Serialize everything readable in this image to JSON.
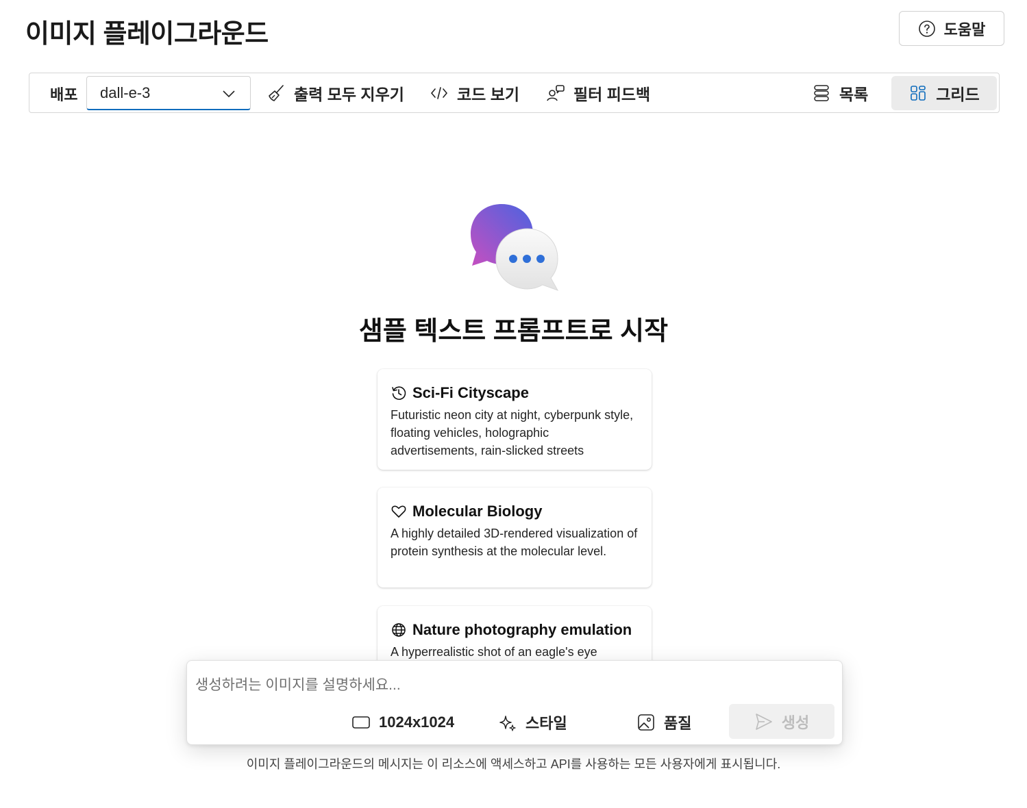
{
  "page": {
    "title": "이미지 플레이그라운드"
  },
  "help": {
    "label": "도움말",
    "icon": "question-circle-icon"
  },
  "toolbar": {
    "deploy_label": "배포",
    "deploy_value": "dall-e-3",
    "clear_label": "출력 모두 지우기",
    "code_label": "코드 보기",
    "feedback_label": "필터 피드백",
    "list_label": "목록",
    "grid_label": "그리드",
    "active_view": "grid"
  },
  "hero": {
    "title": "샘플 텍스트 프롬프트로 시작"
  },
  "samples": [
    {
      "title": "Sci-Fi Cityscape",
      "icon": "history-icon",
      "description": "Futuristic neon city at night, cyberpunk style, floating vehicles, holographic advertisements, rain-slicked streets"
    },
    {
      "title": "Molecular Biology",
      "icon": "heart-icon",
      "description": "A highly detailed 3D-rendered visualization of protein synthesis at the molecular level."
    },
    {
      "title": "Nature photography emulation",
      "icon": "globe-icon",
      "description": "A hyperrealistic shot of an eagle's eye"
    }
  ],
  "composer": {
    "placeholder": "생성하려는 이미지를 설명하세요...",
    "size_label": "1024x1024",
    "style_label": "스타일",
    "quality_label": "품질",
    "generate_label": "생성"
  },
  "footer": {
    "note": "이미지 플레이그라운드의 메시지는 이 리소스에 액세스하고 API를 사용하는 모든 사용자에게 표시됩니다."
  },
  "colors": {
    "accent": "#0f6cbd",
    "hero_gradient_start": "#6a5be0",
    "hero_gradient_end": "#c64fc0",
    "dot_blue": "#2f6fd8"
  }
}
